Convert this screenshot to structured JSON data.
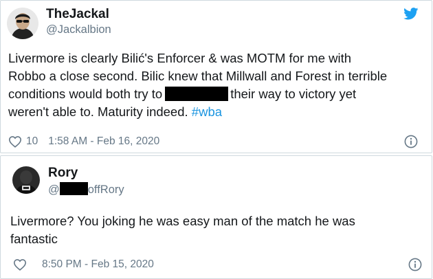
{
  "tweet": {
    "display_name": "TheJackal",
    "handle": "@Jackalbion",
    "text_parts": {
      "line1": "Livermore is clearly Bilić's Enforcer & was MOTM for me with",
      "line2": "Robbo a close second. Bilic knew that Millwall and Forest in terrible",
      "line3_before": "conditions would both try to",
      "line3_after": "their way to victory yet",
      "line4": "weren't able to. Maturity indeed.",
      "hashtag": "#wba"
    },
    "like_count": "10",
    "timestamp": "1:58 AM - Feb 16, 2020"
  },
  "reply": {
    "display_name": "Rory",
    "handle_prefix": "@",
    "handle_suffix": "offRory",
    "text_line1": "Livermore?  You joking he was easy man of the match he was",
    "text_line2": "fantastic",
    "timestamp": "8:50 PM - Feb 15, 2020"
  },
  "icons": {
    "twitter": "twitter-bird-icon",
    "heart": "heart-icon",
    "info": "info-icon"
  },
  "colors": {
    "twitter_blue": "#1da1f2",
    "hashtag": "#1b95e0",
    "muted": "#657786",
    "border": "#cfd9de"
  }
}
